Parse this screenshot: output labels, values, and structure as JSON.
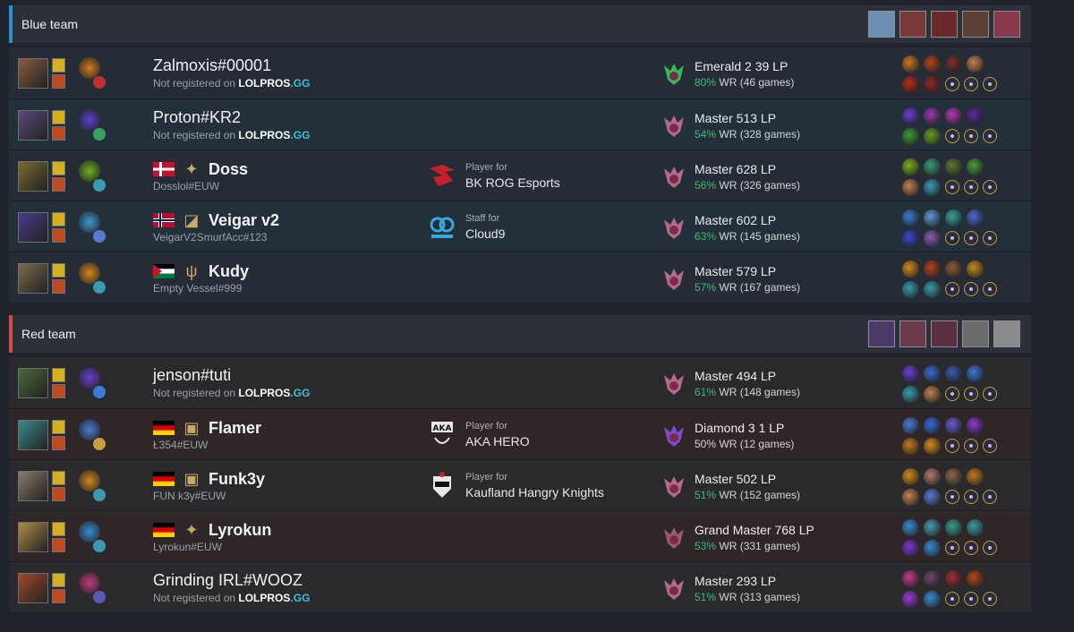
{
  "blue_team": {
    "title": "Blue team",
    "stripe_color": "#2d8fd6",
    "header_champ_colors": [
      "#6b8fb0",
      "#7a3a3a",
      "#6a2a2a",
      "#5a4030",
      "#8a3a4a"
    ],
    "players": [
      {
        "name": "Zalmoxis#00001",
        "bold": false,
        "sub_prefix": "Not registered on ",
        "lolpros": true,
        "flag": null,
        "role_icon": null,
        "team": null,
        "rank": "Emerald 2 39 LP",
        "wr_pct": "80%",
        "wr_rest": " WR (46 games)",
        "rank_color": "#36b85a",
        "champ_color": "#8a5a40",
        "rune_color": "#d07a20",
        "sub_rune_color": "#c03030",
        "build_top": [
          "#c77a22",
          "#b0451f",
          "#7a3030",
          "#c08050"
        ],
        "build_bottom": [
          "#b0301f",
          "#8a2a2a"
        ]
      },
      {
        "name": "Proton#KR2",
        "bold": false,
        "sub_prefix": "Not registered on ",
        "lolpros": true,
        "flag": null,
        "role_icon": null,
        "team": null,
        "rank": "Master 513 LP",
        "wr_pct": "54%",
        "wr_rest": " WR (328 games)",
        "rank_color": "#b46a8a",
        "champ_color": "#5a4a7a",
        "rune_color": "#5a3fd0",
        "sub_rune_color": "#3aa060",
        "build_top": [
          "#6a3fd0",
          "#9a3ab0",
          "#b03ab0",
          "#5a2a9a"
        ],
        "build_bottom": [
          "#3a9a3a",
          "#6a9a2a"
        ]
      },
      {
        "name": "Doss",
        "bold": true,
        "sub_text": "Dosslol#EUW",
        "lolpros": false,
        "flag": "dk",
        "role_icon": "✦",
        "team": {
          "role": "Player for",
          "name": "BK ROG Esports",
          "logo": "rog"
        },
        "rank": "Master 628 LP",
        "wr_pct": "56%",
        "wr_rest": " WR (326 games)",
        "rank_color": "#b46a8a",
        "champ_color": "#7a6a30",
        "rune_color": "#6ab020",
        "sub_rune_color": "#3a9ab0",
        "build_top": [
          "#7ab020",
          "#3a9a7a",
          "#5a7a3a",
          "#4a9a3a"
        ],
        "build_bottom": [
          "#c08050",
          "#3a9ab0"
        ]
      },
      {
        "name": "Veigar v2",
        "bold": true,
        "sub_text": "VeigarV2SmurfAcc#123",
        "lolpros": false,
        "flag": "no",
        "role_icon": "◪",
        "team": {
          "role": "Staff for",
          "name": "Cloud9",
          "logo": "c9"
        },
        "rank": "Master 602 LP",
        "wr_pct": "63%",
        "wr_rest": " WR (145 games)",
        "rank_color": "#b46a8a",
        "champ_color": "#4a3a8a",
        "rune_color": "#3a9ad0",
        "sub_rune_color": "#5a7ad0",
        "build_top": [
          "#3a7ad0",
          "#5a9ad0",
          "#3aa0a0",
          "#4a6ad0"
        ],
        "build_bottom": [
          "#3a4ad0",
          "#8a5ab0"
        ]
      },
      {
        "name": "Kudy",
        "bold": true,
        "sub_text": "Empty Vessel#999",
        "lolpros": false,
        "flag": "ps",
        "role_icon": "ψ",
        "team": null,
        "rank": "Master 579 LP",
        "wr_pct": "57%",
        "wr_rest": " WR (167 games)",
        "rank_color": "#b46a8a",
        "champ_color": "#7a6a4a",
        "rune_color": "#d08a20",
        "sub_rune_color": "#3a9ab0",
        "build_top": [
          "#d08a20",
          "#b0451f",
          "#8a5a3a",
          "#c08a20"
        ],
        "build_bottom": [
          "#3a9ab0",
          "#3a9aa0"
        ]
      }
    ]
  },
  "red_team": {
    "title": "Red team",
    "stripe_color": "#d64a4a",
    "header_champ_colors": [
      "#4a3a6a",
      "#6a3a4a",
      "#5a3040",
      "#6a6a6a",
      "#8a8a8a"
    ],
    "players": [
      {
        "name": "jenson#tuti",
        "bold": false,
        "sub_prefix": "Not registered on ",
        "lolpros": true,
        "flag": null,
        "role_icon": null,
        "team": null,
        "rank": "Master 494 LP",
        "wr_pct": "61%",
        "wr_rest": " WR (148 games)",
        "rank_color": "#b46a8a",
        "champ_color": "#4a6a3a",
        "rune_color": "#6a3fd0",
        "sub_rune_color": "#3a7ad0",
        "build_top": [
          "#6a3fd0",
          "#3a6ad0",
          "#3a5ab0",
          "#3a7ad0"
        ],
        "build_bottom": [
          "#3a9ab0",
          "#c08050"
        ]
      },
      {
        "name": "Flamer",
        "bold": true,
        "sub_text": "Ł354#EUW",
        "lolpros": false,
        "flag": "de",
        "role_icon": "▣",
        "team": {
          "role": "Player for",
          "name": "AKA HERO",
          "logo": "aka"
        },
        "rank": "Diamond 3 1 LP",
        "wr_pct": "50%",
        "wr_rest": " WR (12 games)",
        "wr_plain": true,
        "rank_color": "#7a4ad0",
        "champ_color": "#3a8a8a",
        "rune_color": "#4a7ad0",
        "sub_rune_color": "#c0a040",
        "build_top": [
          "#4a7ad0",
          "#3a6ad0",
          "#6a5ad0",
          "#8a3ad0"
        ],
        "build_bottom": [
          "#c07a20",
          "#d08a20"
        ]
      },
      {
        "name": "Funk3y",
        "bold": true,
        "sub_text": "FUN k3y#EUW",
        "lolpros": false,
        "flag": "de",
        "role_icon": "▣",
        "team": {
          "role": "Player for",
          "name": "Kaufland Hangry Knights",
          "logo": "knights"
        },
        "rank": "Master 502 LP",
        "wr_pct": "51%",
        "wr_rest": " WR (152 games)",
        "rank_color": "#b46a8a",
        "champ_color": "#8a7a6a",
        "rune_color": "#d08a20",
        "sub_rune_color": "#3a9ab0",
        "build_top": [
          "#d08a20",
          "#b07a6a",
          "#8a6a4a",
          "#c07a20"
        ],
        "build_bottom": [
          "#c08050",
          "#5a7ad0"
        ]
      },
      {
        "name": "Lyrokun",
        "bold": true,
        "sub_text": "Lyrokun#EUW",
        "lolpros": false,
        "flag": "de",
        "role_icon": "✦",
        "team": null,
        "rank": "Grand Master 768 LP",
        "wr_pct": "53%",
        "wr_rest": " WR (331 games)",
        "rank_color": "#9a5a6a",
        "champ_color": "#b08a4a",
        "rune_color": "#3a8ad0",
        "sub_rune_color": "#3a9ab0",
        "build_top": [
          "#3a8ad0",
          "#4a9ab0",
          "#3a9a8a",
          "#3a9aa0"
        ],
        "build_bottom": [
          "#7a3ad0",
          "#3a8ad0"
        ]
      },
      {
        "name": "Grinding IRL#WOOZ",
        "bold": false,
        "sub_prefix": "Not registered on ",
        "lolpros": true,
        "flag": null,
        "role_icon": null,
        "team": null,
        "rank": "Master 293 LP",
        "wr_pct": "51%",
        "wr_rest": " WR (313 games)",
        "rank_color": "#b46a8a",
        "champ_color": "#a04a2a",
        "rune_color": "#c03a7a",
        "sub_rune_color": "#5a5ab0",
        "build_top": [
          "#c03a8a",
          "#6a4a6a",
          "#a03030",
          "#b0451f"
        ],
        "build_bottom": [
          "#9a3ad0",
          "#3a8ad0"
        ]
      }
    ]
  },
  "lolpros": {
    "main": "LOLPROS",
    "tld": ".GG"
  }
}
